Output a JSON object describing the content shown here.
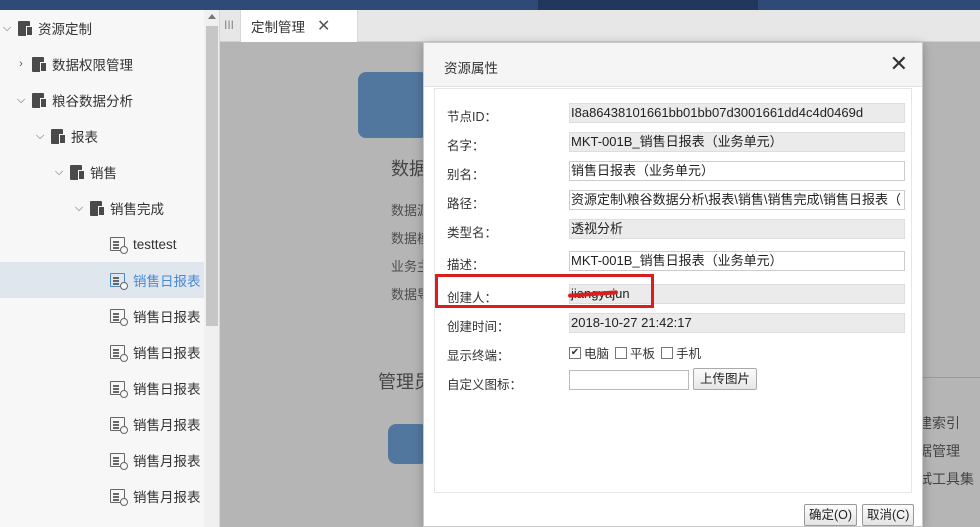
{
  "tree": {
    "items": [
      {
        "label": "资源定制",
        "expanded": true,
        "icon": "folder-icon"
      },
      {
        "label": "数据权限管理",
        "expanded": false,
        "icon": "folder-icon"
      },
      {
        "label": "粮谷数据分析",
        "expanded": true,
        "icon": "folder-icon"
      },
      {
        "label": "报表",
        "expanded": true,
        "icon": "folder-icon"
      },
      {
        "label": "销售",
        "expanded": true,
        "icon": "folder-icon"
      },
      {
        "label": "销售完成",
        "expanded": true,
        "icon": "folder-icon"
      },
      {
        "label": "testtest",
        "icon": "report-icon"
      },
      {
        "label": "销售日报表",
        "icon": "report-icon",
        "selected": true
      },
      {
        "label": "销售日报表",
        "icon": "report-icon"
      },
      {
        "label": "销售日报表",
        "icon": "report-icon"
      },
      {
        "label": "销售日报表",
        "icon": "report-icon"
      },
      {
        "label": "销售月报表",
        "icon": "report-icon"
      },
      {
        "label": "销售月报表",
        "icon": "report-icon"
      },
      {
        "label": "销售月报表",
        "icon": "report-icon"
      }
    ]
  },
  "tabbar": {
    "handle": "III",
    "tab_label": "定制管理",
    "close": "✕"
  },
  "background": {
    "section_title_1": "数据",
    "lines": [
      "数据源",
      "数据模",
      "业务主",
      "数据导"
    ],
    "section_title_2": "管理员",
    "right_items": [
      "建索引",
      "据管理",
      "试工具集"
    ]
  },
  "dialog": {
    "title": "资源属性",
    "close": "✕",
    "fields": {
      "node_id": {
        "label": "节点ID：",
        "value": "I8a86438101661bb01bb07d3001661dd4c4d0469d"
      },
      "name": {
        "label": "名字：",
        "value": "MKT-001B_销售日报表（业务单元）"
      },
      "alias": {
        "label": "别名：",
        "value": "销售日报表（业务单元）"
      },
      "path": {
        "label": "路径：",
        "value": "资源定制\\粮谷数据分析\\报表\\销售\\销售完成\\销售日报表（"
      },
      "type_name": {
        "label": "类型名：",
        "value": "透视分析"
      },
      "description": {
        "label": "描述：",
        "value": "MKT-001B_销售日报表（业务单元）"
      },
      "creator": {
        "label": "创建人：",
        "value": "jiangyajun"
      },
      "created_time": {
        "label": "创建时间：",
        "value": "2018-10-27 21:42:17"
      },
      "display_terminal": {
        "label": "显示终端：",
        "options": [
          {
            "label": "电脑",
            "checked": true
          },
          {
            "label": "平板",
            "checked": false
          },
          {
            "label": "手机",
            "checked": false
          }
        ]
      },
      "custom_icon": {
        "label": "自定义图标：",
        "value": "",
        "upload_label": "上传图片"
      }
    },
    "buttons": {
      "ok": "确定(O)",
      "cancel": "取消(C)"
    }
  },
  "colors": {
    "accent": "#4a8ad0",
    "highlight_box": "#d81e1e",
    "top_bar": "#2f4a77"
  }
}
